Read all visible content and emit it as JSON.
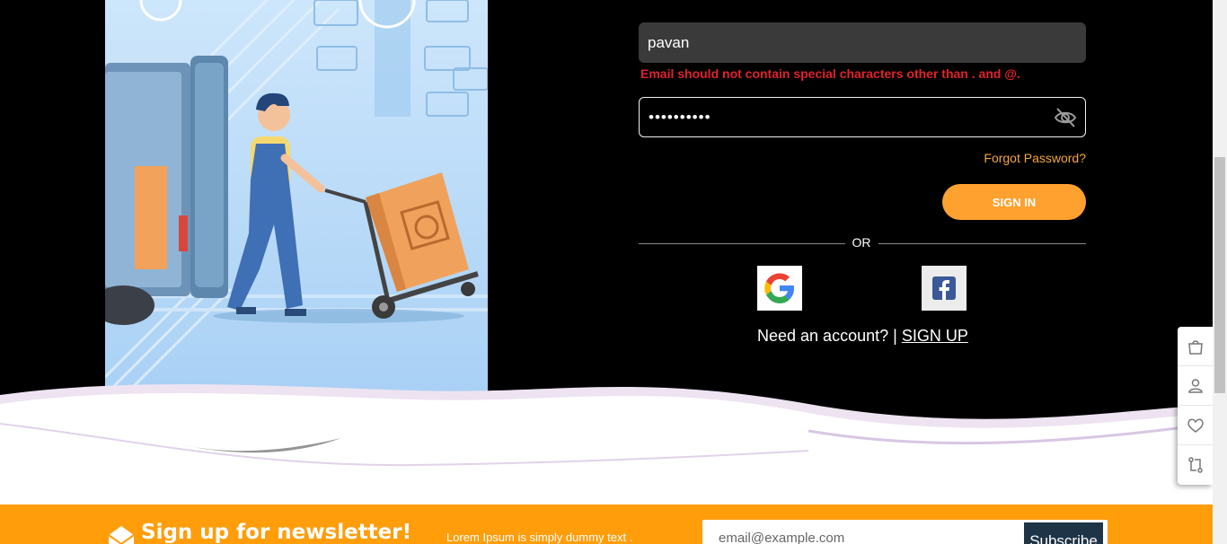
{
  "login": {
    "email_value": "pavan",
    "email_error": "Email should not contain special characters other than . and @.",
    "password_value": "••••••••••",
    "forgot_label": "Forgot Password?",
    "signin_label": "SIGN IN",
    "or_label": "OR",
    "account_prompt": "Need an account? |",
    "signup_label": "SIGN UP"
  },
  "newsletter": {
    "title": "Sign up for newsletter!",
    "subtitle": "Lorem Ipsum is simply dummy text .",
    "email_placeholder": "email@example.com",
    "subscribe_label": "Subscribe"
  },
  "side_widget": {
    "items": [
      "shopping-bag-icon",
      "user-icon",
      "heart-icon",
      "compare-icon"
    ]
  },
  "colors": {
    "accent": "#ffa12e",
    "error": "#e1222d",
    "newsletter_bg": "#ff9d0b",
    "subscribe_bg": "#1f3446"
  }
}
